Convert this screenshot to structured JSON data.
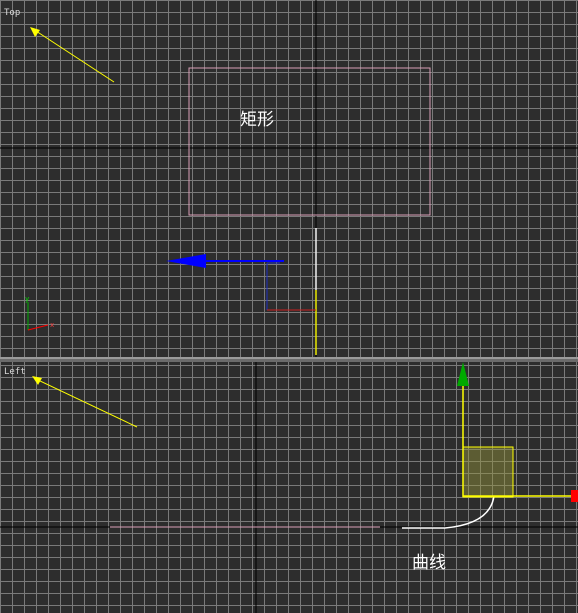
{
  "viewports": {
    "top": {
      "label": "Top",
      "object_label": "矩形"
    },
    "left": {
      "label": "Left",
      "object_label": "曲线"
    }
  },
  "colors": {
    "background": "#2d2d2d",
    "grid": "#7a7a7a",
    "rectangle": "#d9a0b8",
    "light_arrow": "#ffff00",
    "gizmo_x": "#ff0000",
    "gizmo_y": "#00aa00",
    "gizmo_z": "#0000ff",
    "curve": "#ffffff"
  },
  "icons": [
    "light-direction-icon",
    "axis-tripod-icon",
    "transform-gizmo-icon"
  ]
}
